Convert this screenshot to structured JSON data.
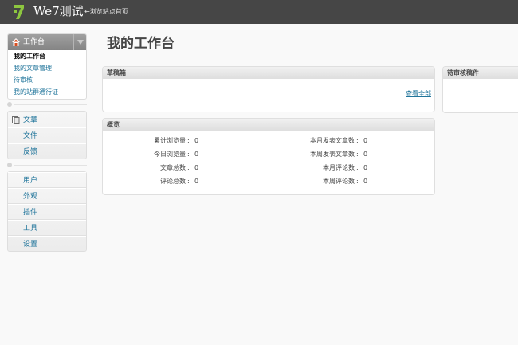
{
  "header": {
    "site_title": "We7测试",
    "view_site_link": "←浏览站点首页"
  },
  "sidebar": {
    "dashboard": {
      "label": "工作台",
      "items": [
        "我的工作台",
        "我的文章管理",
        "待审核",
        "我的站群通行证"
      ]
    },
    "content": [
      {
        "label": "文章",
        "icon": "article-icon"
      },
      {
        "label": "文件",
        "icon": ""
      },
      {
        "label": "反馈",
        "icon": ""
      }
    ],
    "admin": [
      {
        "label": "用户"
      },
      {
        "label": "外观"
      },
      {
        "label": "插件"
      },
      {
        "label": "工具"
      },
      {
        "label": "设置"
      }
    ]
  },
  "main": {
    "page_title": "我的工作台",
    "drafts": {
      "title": "草稿箱",
      "view_all": "查看全部"
    },
    "pending": {
      "title": "待审核稿件"
    },
    "overview": {
      "title": "概览",
      "left": [
        {
          "label": "累计浏览量",
          "value": "0"
        },
        {
          "label": "今日浏览量",
          "value": "0"
        },
        {
          "label": "文章总数",
          "value": "0"
        },
        {
          "label": "评论总数",
          "value": "0"
        }
      ],
      "right": [
        {
          "label": "本月发表文章数",
          "value": "0"
        },
        {
          "label": "本周发表文章数",
          "value": "0"
        },
        {
          "label": "本月评论数",
          "value": "0"
        },
        {
          "label": "本周评论数",
          "value": "0"
        }
      ]
    }
  },
  "colors": {
    "topbar": "#464646",
    "logo_green": "#8dc63f",
    "link": "#21759b"
  }
}
